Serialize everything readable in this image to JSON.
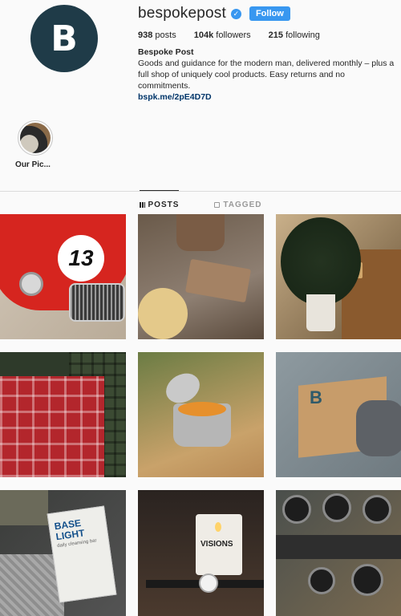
{
  "profile": {
    "avatar_letter": "B",
    "username": "bespokepost",
    "verified_glyph": "✓",
    "follow_label": "Follow",
    "stats": {
      "posts_count": "938",
      "posts_label": "posts",
      "followers_count": "104k",
      "followers_label": "followers",
      "following_count": "215",
      "following_label": "following"
    },
    "bio": {
      "name": "Bespoke Post",
      "text": "Goods and guidance for the modern man, delivered monthly – plus a full shop of uniquely cool products. Easy returns and no commitments.",
      "link": "bspk.me/2pE4D7D"
    }
  },
  "highlights": [
    {
      "label": "Our Pic..."
    }
  ],
  "tabs": [
    {
      "label": "POSTS",
      "icon": "grid-icon",
      "active": true
    },
    {
      "label": "TAGGED",
      "icon": "tag-icon",
      "active": false
    }
  ],
  "posts": [
    {
      "car_number": "13"
    },
    {},
    {},
    {},
    {},
    {
      "box_letter": "B"
    },
    {
      "product_title": "BASE LIGHT",
      "product_subtitle": "daily cleansing bar"
    },
    {
      "candle_label": "VISIONS"
    },
    {}
  ],
  "colors": {
    "accent": "#3897f0",
    "link": "#003569",
    "avatar_bg": "#1f3b48"
  }
}
